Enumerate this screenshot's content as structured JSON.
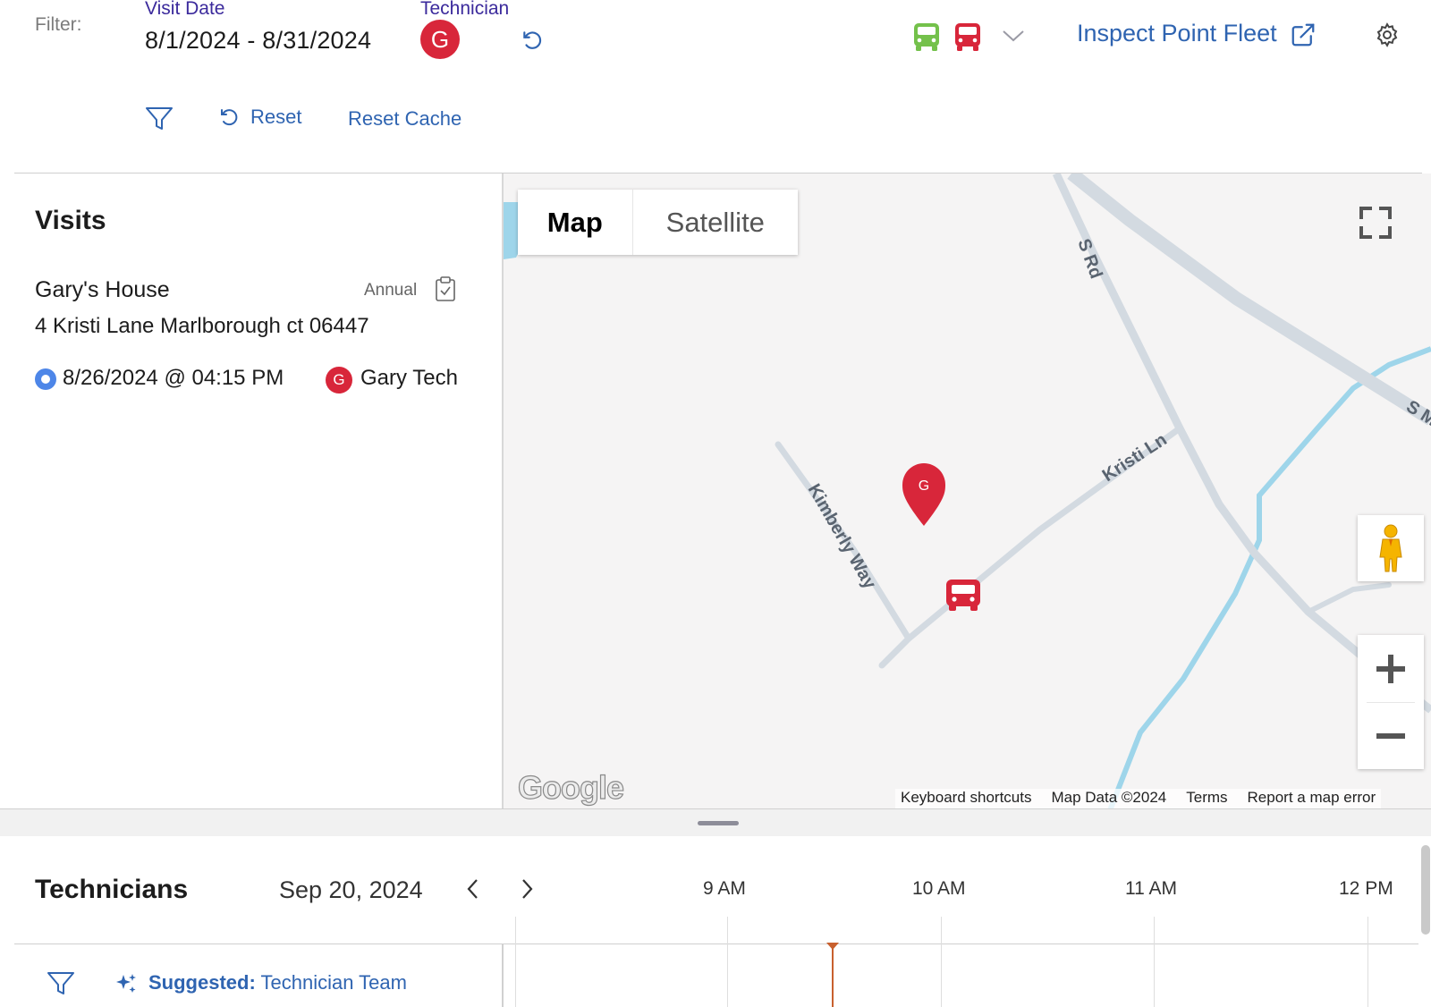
{
  "filters": {
    "label": "Filter:",
    "visit_date_label": "Visit Date",
    "visit_date_value": "8/1/2024 - 8/31/2024",
    "technician_label": "Technician",
    "technician_initial": "G",
    "reset_label": "Reset",
    "reset_cache_label": "Reset Cache"
  },
  "header": {
    "fleet_link": "Inspect Point Fleet"
  },
  "visits": {
    "title": "Visits",
    "items": [
      {
        "name": "Gary's House",
        "type": "Annual",
        "address": "4 Kristi Lane Marlborough ct 06447",
        "when": "8/26/2024 @ 04:15 PM",
        "tech_initial": "G",
        "tech_name": "Gary Tech"
      }
    ]
  },
  "map": {
    "map_label": "Map",
    "satellite_label": "Satellite",
    "marker_initial": "G",
    "streets": {
      "s_rd": "S Rd",
      "kristi_ln": "Kristi Ln",
      "kimberly_way": "Kimberly Way",
      "s_m": "S M"
    },
    "logo": "Google",
    "footer": [
      "Keyboard shortcuts",
      "Map Data ©2024",
      "Terms",
      "Report a map error"
    ]
  },
  "technicians": {
    "title": "Technicians",
    "date": "Sep 20, 2024",
    "hours": [
      "9 AM",
      "10 AM",
      "11 AM",
      "12 PM"
    ],
    "suggested_prefix": "Suggested:",
    "suggested_value": "Technician Team"
  },
  "colors": {
    "accent": "#2f64b1",
    "avatar": "#d8263a",
    "van_green": "#74c14b",
    "van_red": "#d8263a",
    "water": "#9ed5ea",
    "road": "#d3dae1",
    "now_line": "#c8602e"
  },
  "icons": [
    "undo-icon",
    "van-icon",
    "chevron-down-icon",
    "external-link-icon",
    "gear-icon",
    "filter-icon",
    "reset-icon",
    "clipboard-check-icon",
    "fullscreen-icon",
    "pegman-icon",
    "plus-icon",
    "minus-icon",
    "chevron-left-icon",
    "chevron-right-icon",
    "sparkle-icon",
    "map-pin-icon"
  ]
}
